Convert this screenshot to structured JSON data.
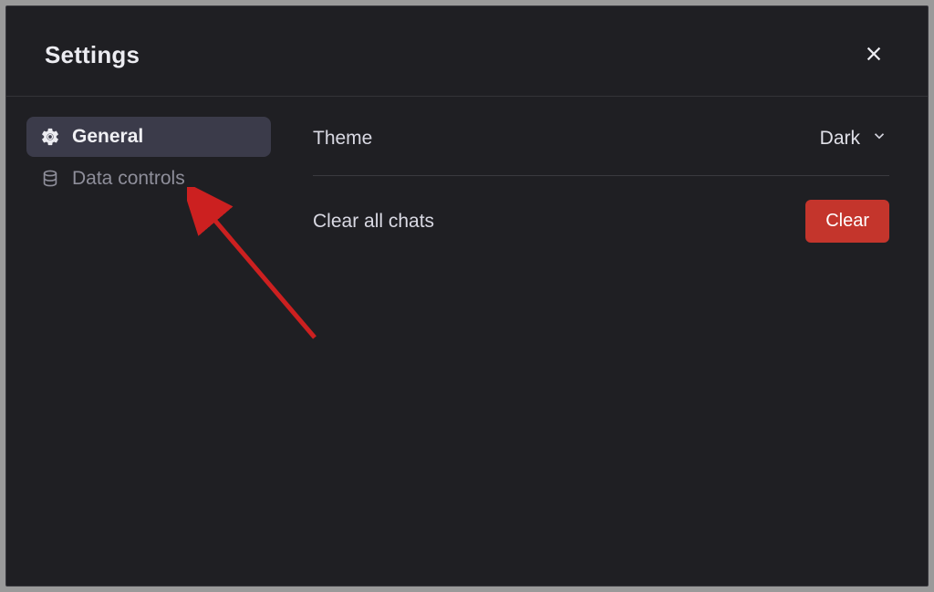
{
  "header": {
    "title": "Settings"
  },
  "sidebar": {
    "items": [
      {
        "label": "General",
        "active": true
      },
      {
        "label": "Data controls",
        "active": false
      }
    ]
  },
  "content": {
    "theme": {
      "label": "Theme",
      "value": "Dark"
    },
    "clear": {
      "label": "Clear all chats",
      "button": "Clear"
    }
  },
  "colors": {
    "background": "#1f1f23",
    "accent_active": "#3b3b4a",
    "danger": "#c4352c",
    "arrow": "#cc2020"
  }
}
